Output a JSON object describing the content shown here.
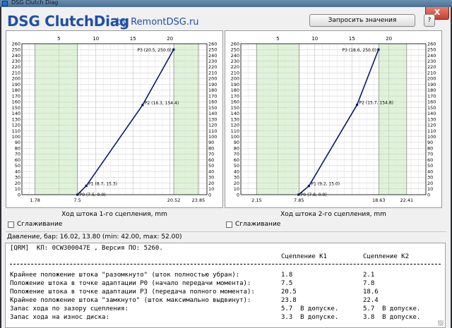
{
  "window": {
    "title": "DSG Clutch Diag",
    "close_glyph": "X"
  },
  "header": {
    "logo": "DSG ClutchDiag",
    "byline": "by RemontDSG.ru",
    "request_button": "Запросить значения",
    "help_button": "?"
  },
  "charts": [
    {
      "xlabel": "Ход штока 1-го сцепления, mm",
      "smoothing_label": "Сглаживание",
      "xtick_labels": [
        "5",
        "10",
        "15",
        "20"
      ],
      "marker_labels": [
        "1.78",
        "7.5",
        "20.52",
        "23.85"
      ]
    },
    {
      "xlabel": "Ход штока 2-го сцепления, mm",
      "smoothing_label": "Сглаживание",
      "xtick_labels": [
        "5",
        "10",
        "15",
        "20"
      ],
      "marker_labels": [
        "2.15",
        "7.85",
        "18.63",
        "22.41"
      ]
    }
  ],
  "chart_data": [
    {
      "type": "line",
      "title": "",
      "xlabel": "Ход штока 1-го сцепления, mm",
      "ylabel": "",
      "xlim": [
        0,
        25
      ],
      "ylim": [
        0,
        260
      ],
      "xticks": [
        5,
        10,
        15,
        20
      ],
      "yticks_step": 10,
      "grid": true,
      "x_bounds": [
        1.78,
        7.5,
        20.52,
        23.85
      ],
      "series": [
        {
          "x": [
            7.5,
            8.7,
            16.3,
            20.5
          ],
          "y": [
            0,
            15.3,
            154.4,
            250
          ]
        }
      ],
      "annotations": [
        "P0 (7.5, 0.0)",
        "P1 (8.7, 15.3)",
        "P2 (16.3, 154.4)",
        "P3 (20.5, 250.0)"
      ]
    },
    {
      "type": "line",
      "title": "",
      "xlabel": "Ход штока 2-го сцепления, mm",
      "ylabel": "",
      "xlim": [
        0,
        25
      ],
      "ylim": [
        0,
        260
      ],
      "xticks": [
        5,
        10,
        15,
        20
      ],
      "yticks_step": 10,
      "grid": true,
      "x_bounds": [
        2.15,
        7.85,
        18.63,
        22.41
      ],
      "series": [
        {
          "x": [
            7.8,
            9.2,
            15.7,
            18.6
          ],
          "y": [
            0,
            15,
            154.8,
            250
          ]
        }
      ],
      "annotations": [
        "P0 (7.8, 0.0)",
        "P1 (9.2, 15.0)",
        "P2 (15.7, 154.8)",
        "P3 (18.6, 250.0)"
      ]
    }
  ],
  "pressure": "Давление, бар: 16.02, 13.80 (min: 42.00, max: 52.00)",
  "report": {
    "line1": "[QRM]  КП: 0CW300047E , Версия ПО: 5260.",
    "col_k1": "Сцепление K1",
    "col_k2": "Сцепление K2",
    "rows": [
      {
        "label": "Крайнее положение штока \"разомкнуто\" (шток полностью убран):",
        "k1": "1.8",
        "k2": "2.1"
      },
      {
        "label": "Положение штока в точке адаптации P0 (начало передачи момента):",
        "k1": "7.5",
        "k2": "7.8"
      },
      {
        "label": "Положение штока в точке адаптации P3 (передача полного момента):",
        "k1": "20.5",
        "k2": "18.6"
      },
      {
        "label": "Крайнее положение штока \"замкнуто\" (шток максимально выдвинут):",
        "k1": "23.8",
        "k2": "22.4"
      },
      {
        "label": "Запас хода по зазору сцепления:",
        "k1": "5.7  В допуске.",
        "k2": "5.7  В допуске."
      },
      {
        "label": "Запас хода на износ диска:",
        "k1": "3.3  В допуске.",
        "k2": "3.8  В допуске."
      }
    ]
  },
  "colors": {
    "accent": "#1f4fa8",
    "series": "#0a1a6e",
    "zone": "#dff3d8"
  }
}
